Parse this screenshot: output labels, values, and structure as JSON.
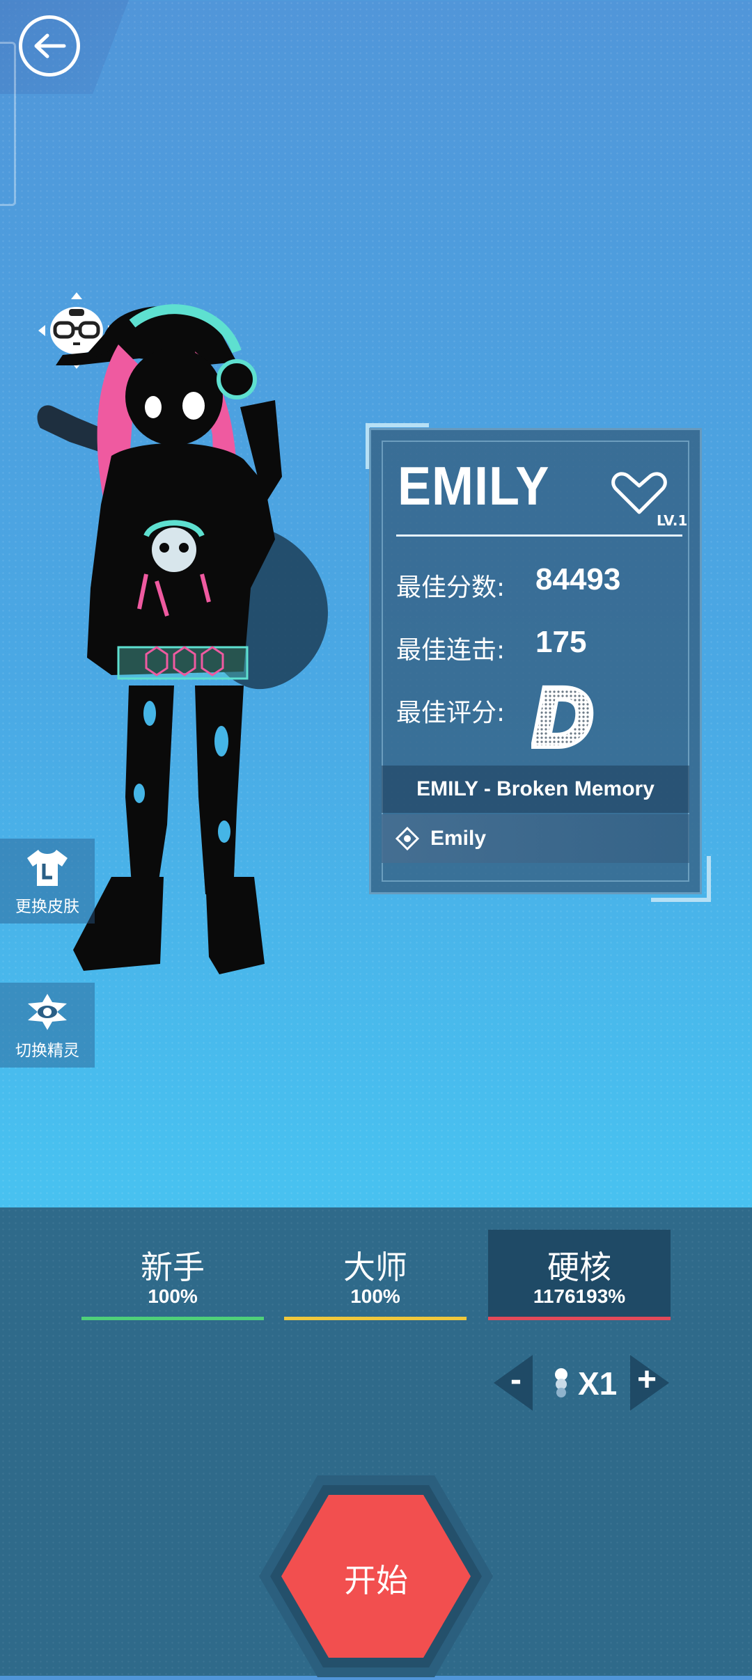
{
  "colors": {
    "accent_start": "#f24f4f",
    "easy": "#4fd07a",
    "master": "#f0c83c",
    "hardcore": "#e24a5a",
    "character_pink": "#ef5aa0",
    "character_teal": "#5ee0d0"
  },
  "nav": {
    "back_icon": "back-arrow-icon"
  },
  "side_buttons": [
    {
      "label": "更换皮肤",
      "icon": "tshirt-icon"
    },
    {
      "label": "切换精灵",
      "icon": "eye-icon"
    }
  ],
  "card": {
    "name": "EMILY",
    "level": "LV.1",
    "stats": [
      {
        "label": "最佳分数:",
        "value": "84493"
      },
      {
        "label": "最佳连击:",
        "value": "175"
      },
      {
        "label": "最佳评分:",
        "value": ""
      }
    ],
    "best_rank": "D",
    "song": "EMILY - Broken Memory",
    "skin": "Emily"
  },
  "difficulties": [
    {
      "name": "新手",
      "percent": "100%",
      "color": "#4fd07a",
      "selected": false
    },
    {
      "name": "大师",
      "percent": "100%",
      "color": "#f0c83c",
      "selected": false
    },
    {
      "name": "硬核",
      "percent": "1176193%",
      "color": "#e24a5a",
      "selected": true
    }
  ],
  "speed": {
    "minus": "-",
    "value": "X1",
    "plus": "+"
  },
  "start_button": {
    "label": "开始"
  }
}
